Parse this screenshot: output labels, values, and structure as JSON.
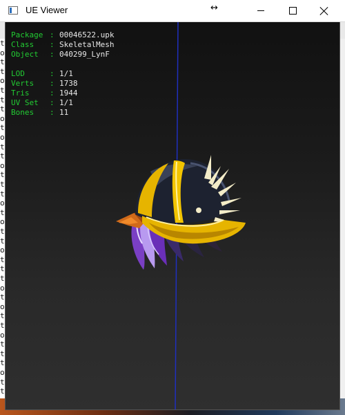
{
  "window": {
    "title": "UE Viewer",
    "app_icon": "window-app-icon",
    "cursor_icon": "horizontal-resize-cursor-icon",
    "controls": {
      "minimize": "minimize-icon",
      "maximize": "maximize-icon",
      "close": "close-icon"
    }
  },
  "background_console": {
    "lines": [
      "t",
      "o",
      "t",
      "t",
      "o",
      "t",
      "t",
      "t",
      "o",
      "t",
      "o",
      "t",
      "t",
      "o",
      "t",
      "t",
      "t",
      "o",
      "t",
      "o",
      "t",
      "t",
      "o",
      "t",
      "t",
      "t",
      "o",
      "t",
      "o",
      "t",
      "t",
      "o",
      "t",
      "t",
      "t",
      "o",
      "t",
      "t"
    ]
  },
  "info_panel": {
    "object_rows": [
      {
        "label": "Package",
        "sep": ":",
        "value": "00046522.upk"
      },
      {
        "label": "Class",
        "sep": ":",
        "value": "SkeletalMesh"
      },
      {
        "label": "Object",
        "sep": ":",
        "value": "040299_LynF"
      }
    ],
    "mesh_rows": [
      {
        "label": "LOD",
        "sep": ":",
        "value": "1/1"
      },
      {
        "label": "Verts",
        "sep": ":",
        "value": "1738"
      },
      {
        "label": "Tris",
        "sep": ":",
        "value": "1944"
      },
      {
        "label": "UV Set",
        "sep": ":",
        "value": "1/1"
      },
      {
        "label": "Bones",
        "sep": ":",
        "value": "11"
      }
    ]
  },
  "viewport": {
    "model_name": "spiked-cap-mesh",
    "colors": {
      "label_green": "#22cc33",
      "value_white": "#e8e8e8",
      "axis_blue": "#1f2fbf",
      "cap_dark": "#1d2230",
      "cap_yellow": "#e6b400",
      "hair_purple": "#8a5ad6",
      "bandana_orange": "#d06a1a",
      "spike_cream": "#f3ecc8"
    }
  }
}
